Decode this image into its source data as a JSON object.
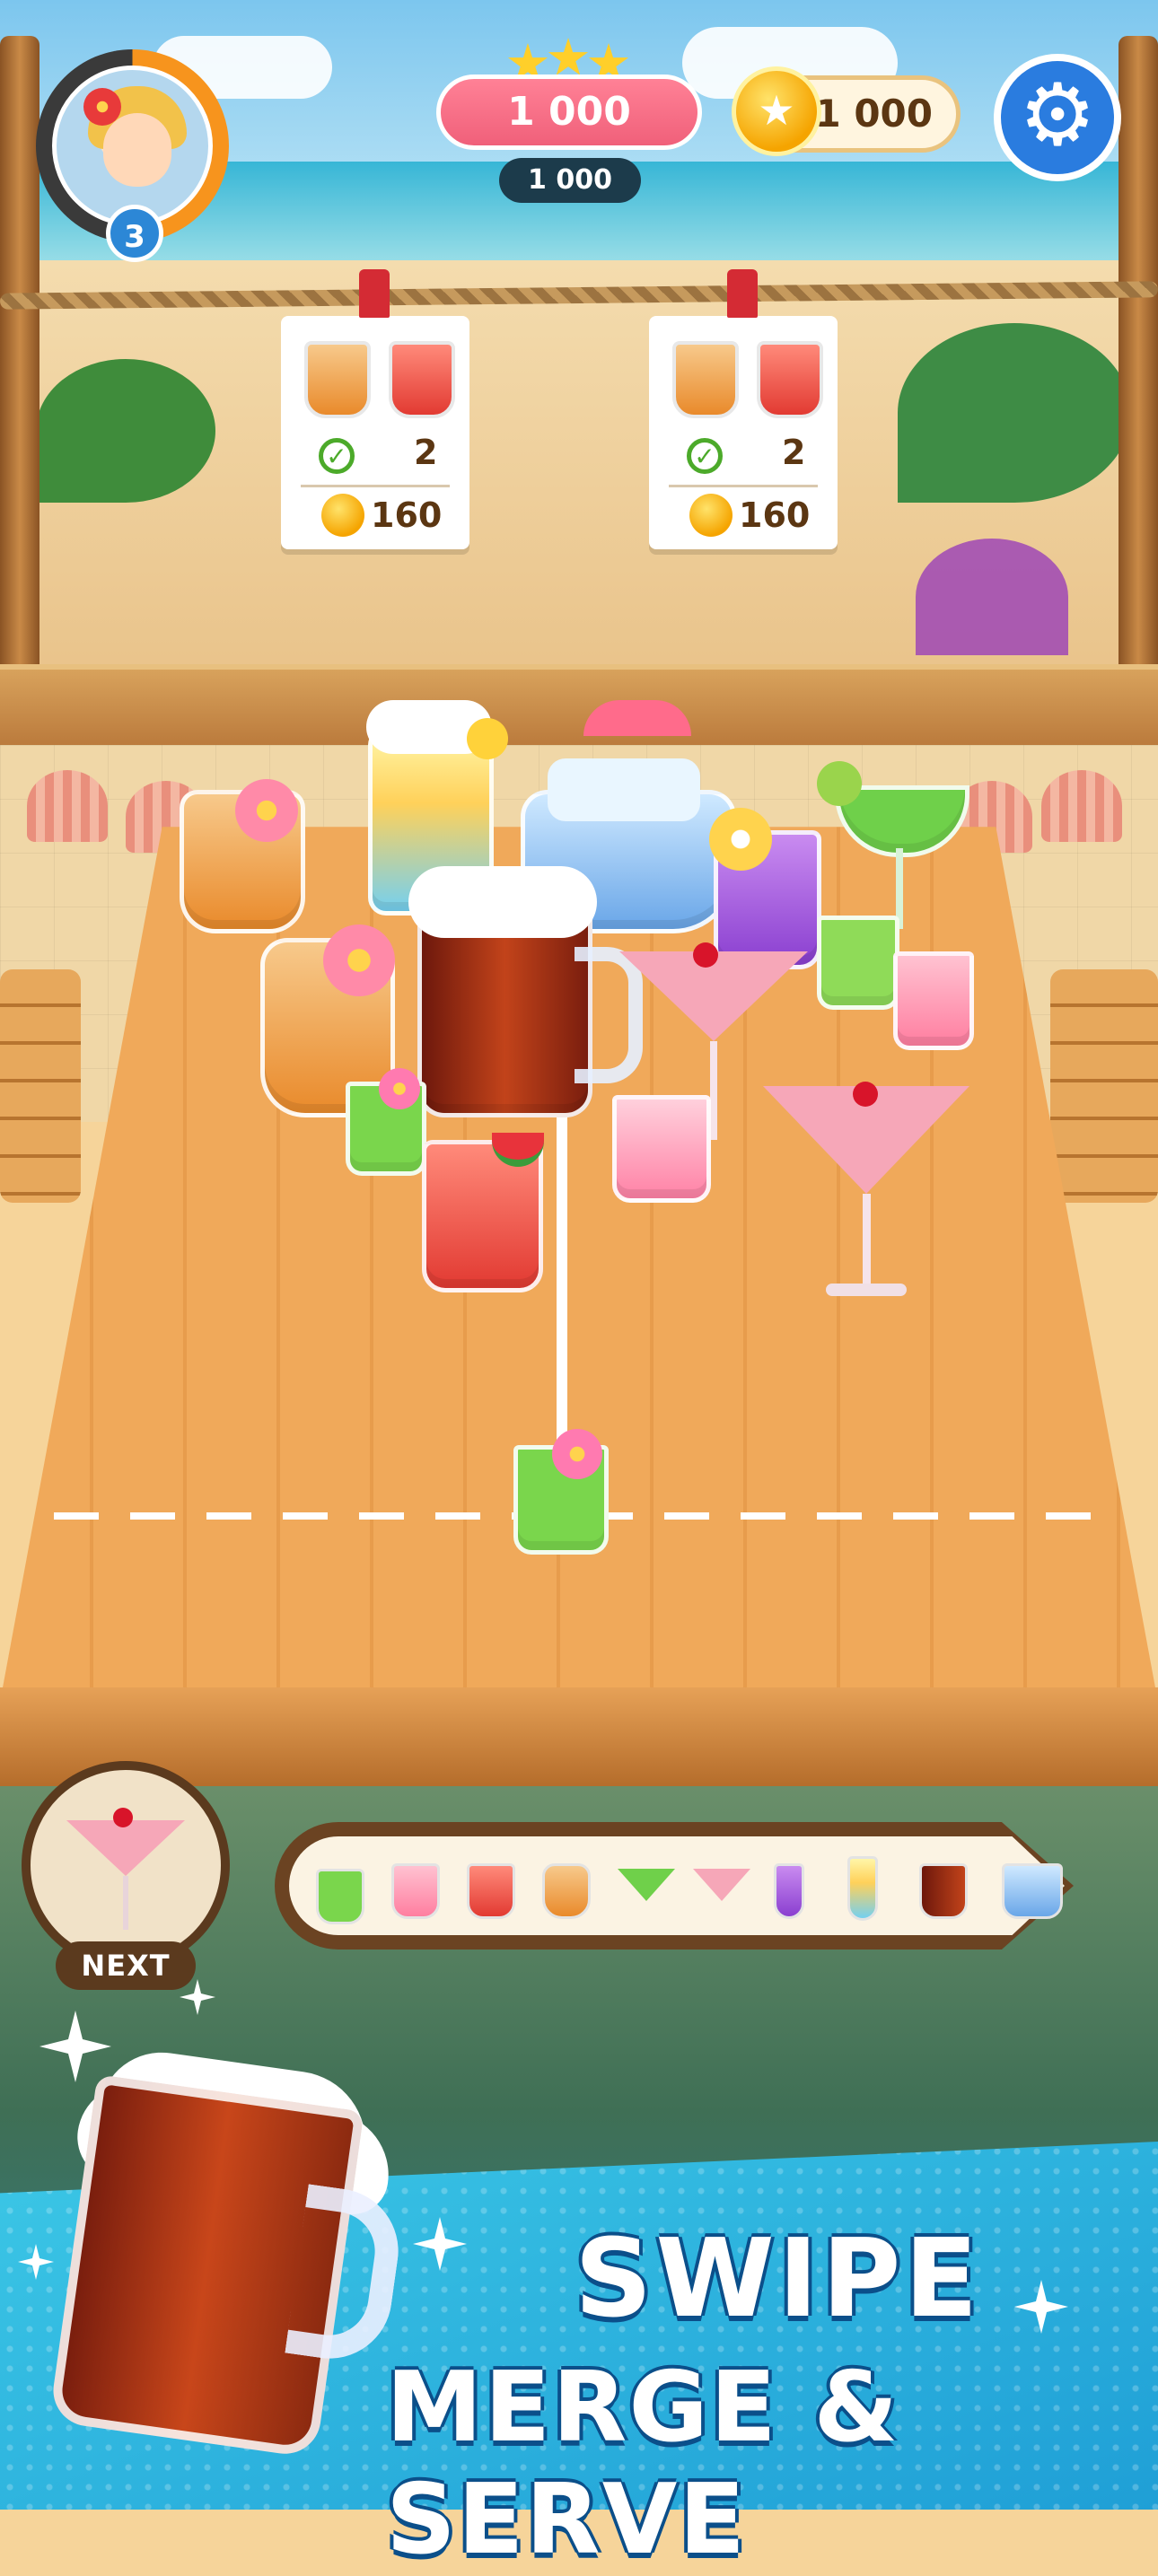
{
  "hud": {
    "player": {
      "level": "3",
      "progress": 0.48
    },
    "score": {
      "value": "1 000",
      "stars": 3,
      "sub_value": "1 000"
    },
    "coins": {
      "value": "1 000"
    },
    "settings_icon": "gear-icon"
  },
  "orders": [
    {
      "items": [
        "tropical-orange-cocktail",
        "watermelon-punch"
      ],
      "done_icon": "check-icon",
      "count": "2",
      "reward": "160"
    },
    {
      "items": [
        "tropical-orange-cocktail",
        "watermelon-punch"
      ],
      "done_icon": "check-icon",
      "count": "2",
      "reward": "160"
    }
  ],
  "next": {
    "label": "NEXT",
    "drink": "pink-cherry-martini"
  },
  "merge_chain": [
    "green-lime-shot",
    "pink-lemonade",
    "watermelon-punch",
    "tropical-orange-cocktail",
    "green-margarita",
    "pink-cherry-martini",
    "purple-orchid-drink",
    "rainbow-smoothie",
    "root-beer-mug",
    "ice-bucket-punch"
  ],
  "banner": {
    "line1": "SWIPE",
    "line2": "MERGE & SERVE"
  },
  "colors": {
    "accent_pink": "#f0607a",
    "settings_blue": "#2a7cdf",
    "wood": "#f0a95a",
    "banner_blue": "#1f9fd6"
  }
}
